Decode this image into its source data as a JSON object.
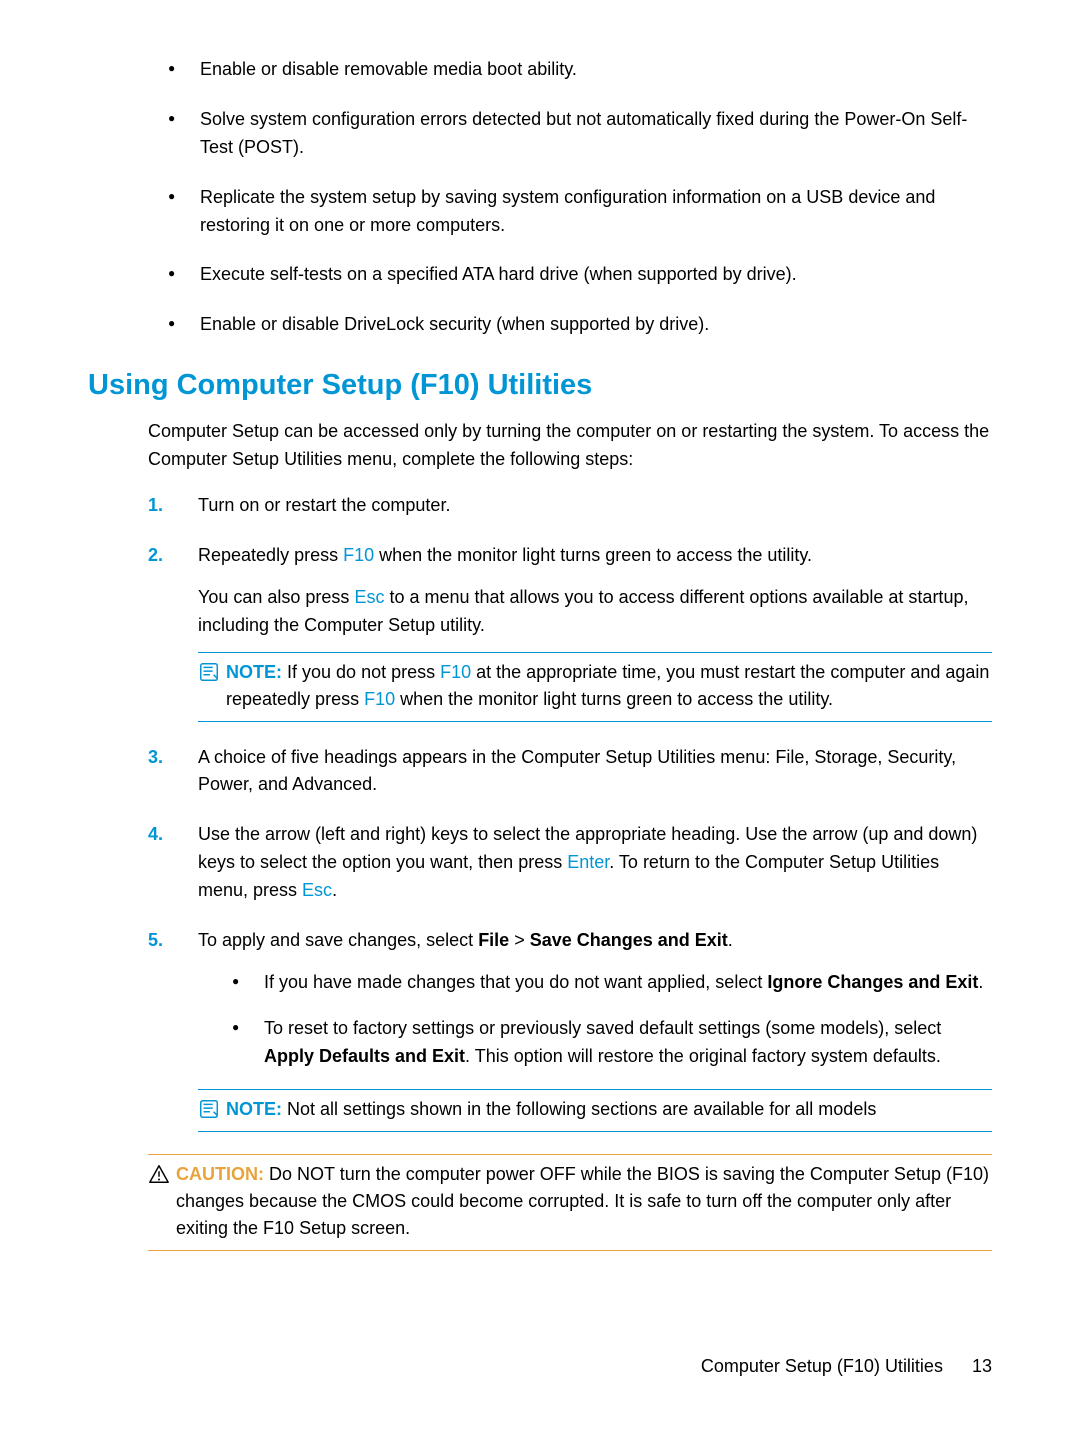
{
  "topBullets": [
    "Enable or disable removable media boot ability.",
    "Solve system configuration errors detected but not automatically fixed during the Power-On Self-Test (POST).",
    "Replicate the system setup by saving system configuration information on a USB device and restoring it on one or more computers.",
    "Execute self-tests on a specified ATA hard drive (when supported by drive).",
    "Enable or disable DriveLock security (when supported by drive)."
  ],
  "sectionHeading": "Using Computer Setup (F10) Utilities",
  "intro": "Computer Setup can be accessed only by turning the computer on or restarting the system. To access the Computer Setup Utilities menu, complete the following steps:",
  "step1": "Turn on or restart the computer.",
  "step2_a": "Repeatedly press ",
  "step2_key1": "F10",
  "step2_b": " when the monitor light turns green to access the utility.",
  "step2_para_a": "You can also press ",
  "step2_para_key": "Esc",
  "step2_para_b": " to a menu that allows you to access different options available at startup, including the Computer Setup utility.",
  "note1_label": "NOTE:",
  "note1_a": "If you do not press ",
  "note1_key1": "F10",
  "note1_b": " at the appropriate time, you must restart the computer and again repeatedly press ",
  "note1_key2": "F10",
  "note1_c": " when the monitor light turns green to access the utility.",
  "step3": "A choice of five headings appears in the Computer Setup Utilities menu: File, Storage, Security, Power, and Advanced.",
  "step4_a": "Use the arrow (left and right) keys to select the appropriate heading. Use the arrow (up and down) keys to select the option you want, then press ",
  "step4_key1": "Enter",
  "step4_b": ". To return to the Computer Setup Utilities menu, press ",
  "step4_key2": "Esc",
  "step4_c": ".",
  "step5_a": "To apply and save changes, select ",
  "step5_bold1": "File",
  "step5_gt": " > ",
  "step5_bold2": "Save Changes and Exit",
  "step5_b": ".",
  "sub1_a": "If you have made changes that you do not want applied, select ",
  "sub1_bold": "Ignore Changes and Exit",
  "sub1_b": ".",
  "sub2_a": "To reset to factory settings or previously saved default settings (some models), select ",
  "sub2_bold": "Apply Defaults and Exit",
  "sub2_b": ". This option will restore the original factory system defaults.",
  "note2_label": "NOTE:",
  "note2_text": "Not all settings shown in the following sections are available for all models",
  "caution_label": "CAUTION:",
  "caution_text": "Do NOT turn the computer power OFF while the BIOS is saving the Computer Setup (F10) changes because the CMOS could become corrupted. It is safe to turn off the computer only after exiting the F10 Setup screen.",
  "footer_text": "Computer Setup (F10) Utilities",
  "footer_page": "13"
}
